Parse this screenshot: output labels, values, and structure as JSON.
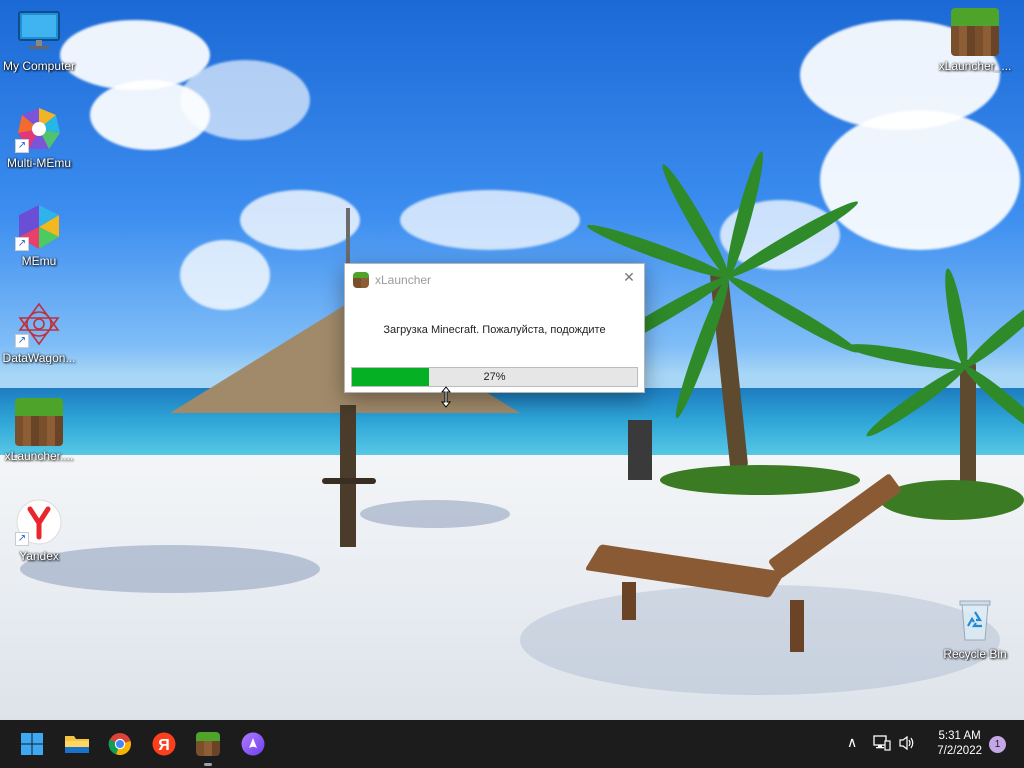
{
  "desktop": {
    "icons_left": [
      {
        "label": "My Computer",
        "icon": "monitor-icon"
      },
      {
        "label": "Multi-MEmu",
        "icon": "multi-memu-icon"
      },
      {
        "label": "MEmu",
        "icon": "memu-icon"
      },
      {
        "label": "DataWagon...",
        "icon": "datawagon-icon"
      },
      {
        "label": "xLauncher....",
        "icon": "minecraft-grass-icon"
      },
      {
        "label": "Yandex",
        "icon": "yandex-icon"
      }
    ],
    "icons_right": [
      {
        "label": "xLauncher_...",
        "icon": "minecraft-grass-icon"
      },
      {
        "label": "Recycle Bin",
        "icon": "recycle-bin-icon"
      }
    ]
  },
  "dialog": {
    "title": "xLauncher",
    "message": "Загрузка Minecraft. Пожалуйста, подождите",
    "progress_percent": 27,
    "progress_text": "27%",
    "progress_color": "#06b025",
    "close_glyph": "✕"
  },
  "taskbar": {
    "apps": [
      {
        "name": "start-button",
        "icon": "windows-icon"
      },
      {
        "name": "file-explorer",
        "icon": "folder-icon"
      },
      {
        "name": "chrome",
        "icon": "chrome-icon"
      },
      {
        "name": "yandex-browser",
        "icon": "yandex-icon"
      },
      {
        "name": "xlauncher",
        "icon": "minecraft-grass-icon",
        "running": true
      },
      {
        "name": "alice",
        "icon": "alice-icon"
      }
    ],
    "time": "5:31 AM",
    "date": "7/2/2022",
    "notification_count": "1",
    "chevron_glyph": "∧"
  }
}
